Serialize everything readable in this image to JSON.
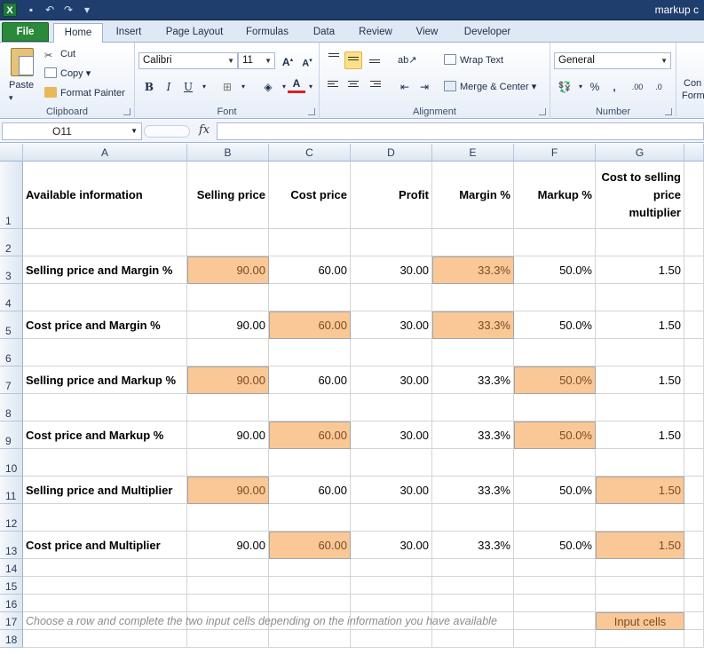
{
  "window": {
    "title": "markup c",
    "app_icon": "X"
  },
  "quick_access": [
    "save-icon",
    "undo-icon",
    "redo-icon",
    "customize-icon"
  ],
  "tabs": [
    "File",
    "Home",
    "Insert",
    "Page Layout",
    "Formulas",
    "Data",
    "Review",
    "View",
    "Developer"
  ],
  "active_tab": "Home",
  "clipboard": {
    "paste": "Paste",
    "cut": "Cut",
    "copy": "Copy",
    "format_painter": "Format Painter",
    "label": "Clipboard"
  },
  "font": {
    "name": "Calibri",
    "size": "11",
    "bold": "B",
    "italic": "I",
    "underline": "U",
    "label": "Font",
    "font_color": "#e02020"
  },
  "alignment": {
    "wrap_text": "Wrap Text",
    "merge_center": "Merge & Center",
    "label": "Alignment"
  },
  "number": {
    "format": "General",
    "percent": "%",
    "comma": ",",
    "label": "Number",
    "inc_decimal": ".00",
    "dec_decimal": ".0"
  },
  "cut_off": {
    "line1": "Con",
    "line2": "Form"
  },
  "formula_bar": {
    "cell_ref": "O11",
    "fx": "fx",
    "formula": ""
  },
  "columns": [
    "A",
    "B",
    "C",
    "D",
    "E",
    "F",
    "G"
  ],
  "headers": {
    "A": "Available information",
    "B": "Selling price",
    "C": "Cost price",
    "D": "Profit",
    "E": "Margin %",
    "F": "Markup %",
    "G": "Cost to selling price multiplier"
  },
  "rows": [
    {
      "row": "3",
      "label": "Selling price and Margin %",
      "selling": "90.00",
      "cost": "60.00",
      "profit": "30.00",
      "margin": "33.3%",
      "markup": "50.0%",
      "multiplier": "1.50",
      "inputs": [
        "B",
        "E"
      ]
    },
    {
      "row": "5",
      "label": "Cost price and Margin %",
      "selling": "90.00",
      "cost": "60.00",
      "profit": "30.00",
      "margin": "33.3%",
      "markup": "50.0%",
      "multiplier": "1.50",
      "inputs": [
        "C",
        "E"
      ]
    },
    {
      "row": "7",
      "label": "Selling price and Markup %",
      "selling": "90.00",
      "cost": "60.00",
      "profit": "30.00",
      "margin": "33.3%",
      "markup": "50.0%",
      "multiplier": "1.50",
      "inputs": [
        "B",
        "F"
      ]
    },
    {
      "row": "9",
      "label": "Cost price and Markup %",
      "selling": "90.00",
      "cost": "60.00",
      "profit": "30.00",
      "margin": "33.3%",
      "markup": "50.0%",
      "multiplier": "1.50",
      "inputs": [
        "C",
        "F"
      ]
    },
    {
      "row": "11",
      "label": "Selling price and Multiplier",
      "selling": "90.00",
      "cost": "60.00",
      "profit": "30.00",
      "margin": "33.3%",
      "markup": "50.0%",
      "multiplier": "1.50",
      "inputs": [
        "B",
        "G"
      ]
    },
    {
      "row": "13",
      "label": "Cost price and Multiplier",
      "selling": "90.00",
      "cost": "60.00",
      "profit": "30.00",
      "margin": "33.3%",
      "markup": "50.0%",
      "multiplier": "1.50",
      "inputs": [
        "C",
        "G"
      ]
    }
  ],
  "row_numbers": [
    "1",
    "2",
    "3",
    "4",
    "5",
    "6",
    "7",
    "8",
    "9",
    "10",
    "11",
    "12",
    "13",
    "14",
    "15",
    "16",
    "17",
    "18"
  ],
  "note": "Choose a row and complete the two input cells depending on the information you have available",
  "legend": "Input cells",
  "colors": {
    "input_fill": "#fac896",
    "file_tab": "#2a8a3a",
    "title_bar": "#1f3d6d"
  }
}
